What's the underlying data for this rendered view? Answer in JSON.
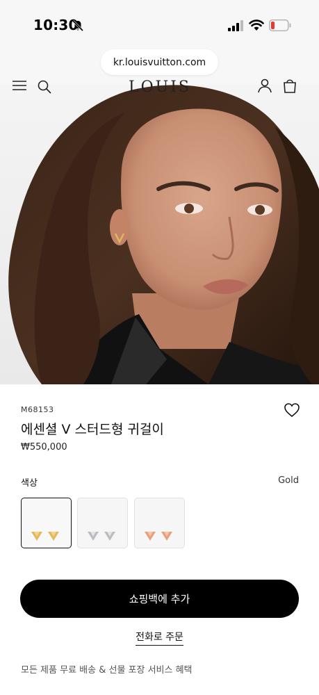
{
  "status_bar": {
    "time": "10:30"
  },
  "browser": {
    "url": "kr.louisvuitton.com"
  },
  "header": {
    "logo": "LOUIS VUITTON"
  },
  "product": {
    "sku": "M68153",
    "name": "에센셜 V 스터드형 귀걸이",
    "price": "₩550,000"
  },
  "color": {
    "label": "색상",
    "value": "Gold",
    "swatches": [
      {
        "name": "gold",
        "tint": "#e6b65a"
      },
      {
        "name": "silver",
        "tint": "#b9bcc0"
      },
      {
        "name": "rose-gold",
        "tint": "#e8a07a"
      }
    ]
  },
  "actions": {
    "add_to_cart": "쇼핑백에 추가",
    "phone_order": "전화로 주문"
  },
  "benefits": "모든 제품 무료 배송 & 선물 포장 서비스 혜택"
}
